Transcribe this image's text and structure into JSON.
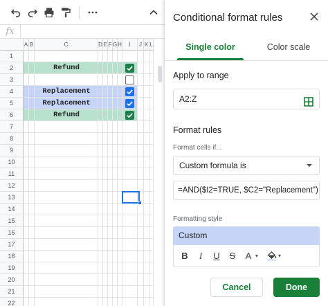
{
  "sheet": {
    "formula_label": "fx",
    "columns": [
      "A",
      "B",
      "C",
      "D",
      "E",
      "F",
      "G",
      "H",
      "I",
      "J",
      "K",
      "L"
    ],
    "rows": [
      {
        "num": "1",
        "text": "",
        "checkbox": "none",
        "fill": ""
      },
      {
        "num": "2",
        "text": "Refund",
        "checkbox": "checked",
        "fill": "green"
      },
      {
        "num": "3",
        "text": "",
        "checkbox": "unchecked",
        "fill": ""
      },
      {
        "num": "4",
        "text": "Replacement",
        "checkbox": "checked",
        "fill": "blue"
      },
      {
        "num": "5",
        "text": "Replacement",
        "checkbox": "checked",
        "fill": "blue"
      },
      {
        "num": "6",
        "text": "Refund",
        "checkbox": "checked",
        "fill": "green"
      },
      {
        "num": "7",
        "text": "",
        "checkbox": "none",
        "fill": ""
      },
      {
        "num": "8",
        "text": "",
        "checkbox": "none",
        "fill": ""
      },
      {
        "num": "9",
        "text": "",
        "checkbox": "none",
        "fill": ""
      },
      {
        "num": "10",
        "text": "",
        "checkbox": "none",
        "fill": ""
      },
      {
        "num": "11",
        "text": "",
        "checkbox": "none",
        "fill": ""
      },
      {
        "num": "12",
        "text": "",
        "checkbox": "none",
        "fill": ""
      },
      {
        "num": "13",
        "text": "",
        "checkbox": "none",
        "fill": ""
      },
      {
        "num": "14",
        "text": "",
        "checkbox": "none",
        "fill": ""
      },
      {
        "num": "15",
        "text": "",
        "checkbox": "none",
        "fill": ""
      },
      {
        "num": "16",
        "text": "",
        "checkbox": "none",
        "fill": ""
      },
      {
        "num": "17",
        "text": "",
        "checkbox": "none",
        "fill": ""
      },
      {
        "num": "18",
        "text": "",
        "checkbox": "none",
        "fill": ""
      },
      {
        "num": "19",
        "text": "",
        "checkbox": "none",
        "fill": ""
      },
      {
        "num": "20",
        "text": "",
        "checkbox": "none",
        "fill": ""
      },
      {
        "num": "21",
        "text": "",
        "checkbox": "none",
        "fill": ""
      },
      {
        "num": "22",
        "text": "",
        "checkbox": "none",
        "fill": ""
      }
    ],
    "colors": {
      "green_fill": "#b7e1cd",
      "blue_fill": "#c6d4f8",
      "checkbox_blue": "#1a73e8",
      "checkbox_green": "#1e7f4c"
    }
  },
  "toolbar_icons": [
    "undo-icon",
    "redo-icon",
    "print-icon",
    "paint-format-icon",
    "more-icon",
    "chevron-up-icon"
  ],
  "sidebar": {
    "title": "Conditional format rules",
    "tabs": {
      "single": "Single color",
      "scale": "Color scale"
    },
    "apply_label": "Apply to range",
    "range": "A2:Z",
    "format_rules_label": "Format rules",
    "format_cells_if": "Format cells if...",
    "condition": "Custom formula is",
    "formula": "=AND($I2=TRUE, $C2=\"Replacement\")",
    "formatting_style_label": "Formatting style",
    "style_preview": "Custom",
    "style_buttons": {
      "bold": "B",
      "italic": "I",
      "underline": "U",
      "strike": "S",
      "text_color": "A"
    },
    "cancel": "Cancel",
    "done": "Done",
    "accent": "#188038",
    "preview_fill": "#c6d4f8"
  }
}
